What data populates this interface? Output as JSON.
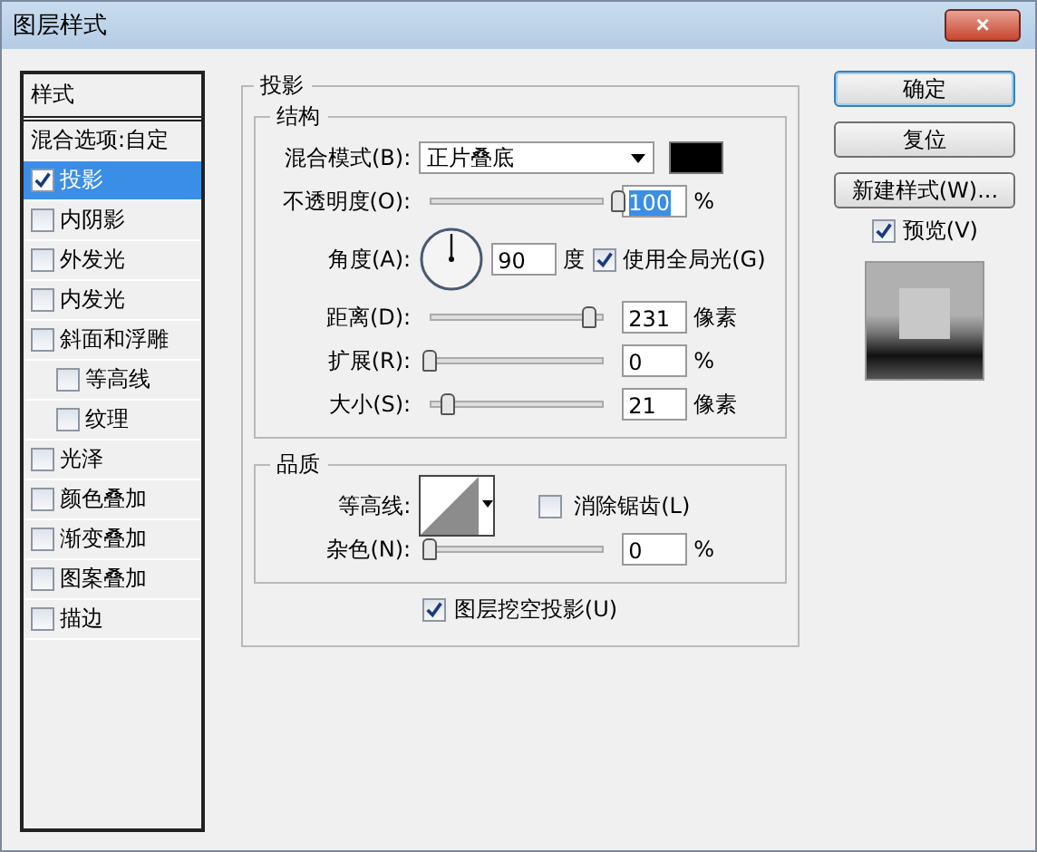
{
  "window": {
    "title": "图层样式",
    "close_button": "×"
  },
  "styles": {
    "header": "样式",
    "items": [
      {
        "label": "混合选项:自定",
        "kind": "plain",
        "selected": false
      },
      {
        "label": "投影",
        "kind": "check",
        "checked": true,
        "selected": true
      },
      {
        "label": "内阴影",
        "kind": "check",
        "checked": false,
        "selected": false
      },
      {
        "label": "外发光",
        "kind": "check",
        "checked": false,
        "selected": false
      },
      {
        "label": "内发光",
        "kind": "check",
        "checked": false,
        "selected": false
      },
      {
        "label": "斜面和浮雕",
        "kind": "check",
        "checked": false,
        "selected": false,
        "children": [
          {
            "label": "等高线",
            "kind": "check",
            "checked": false,
            "selected": false
          },
          {
            "label": "纹理",
            "kind": "check",
            "checked": false,
            "selected": false
          }
        ]
      },
      {
        "label": "光泽",
        "kind": "check",
        "checked": false,
        "selected": false
      },
      {
        "label": "颜色叠加",
        "kind": "check",
        "checked": false,
        "selected": false
      },
      {
        "label": "渐变叠加",
        "kind": "check",
        "checked": false,
        "selected": false
      },
      {
        "label": "图案叠加",
        "kind": "check",
        "checked": false,
        "selected": false
      },
      {
        "label": "描边",
        "kind": "check",
        "checked": false,
        "selected": false
      }
    ]
  },
  "panel": {
    "title": "投影",
    "structure": {
      "title": "结构",
      "blend_mode": {
        "label": "混合模式(B):",
        "value": "正片叠底",
        "color": "#000000"
      },
      "rows": [
        {
          "kind": "slider",
          "label": "不透明度(O):",
          "level": 1.0,
          "value": "100",
          "unit": "%",
          "highlighted": true
        },
        {
          "kind": "angle",
          "label": "角度(A):",
          "value": "90",
          "unit": "度",
          "checkbox": {
            "label": "使用全局光(G)",
            "checked": true
          }
        },
        {
          "kind": "slider",
          "label": "距离(D):",
          "level": 0.85,
          "value": "231",
          "unit": "像素",
          "highlighted": false
        },
        {
          "kind": "slider",
          "label": "扩展(R):",
          "level": 0.0,
          "value": "0",
          "unit": "%",
          "highlighted": false
        },
        {
          "kind": "slider",
          "label": "大小(S):",
          "level": 0.1,
          "value": "21",
          "unit": "像素",
          "highlighted": false
        }
      ]
    },
    "quality": {
      "title": "品质",
      "contour": {
        "label": "等高线:",
        "checkbox": {
          "label": "消除锯齿(L)",
          "checked": false
        }
      },
      "noise": {
        "label": "杂色(N):",
        "level": 0.0,
        "value": "0",
        "unit": "%"
      }
    },
    "knockout": {
      "label": "图层挖空投影(U)",
      "checked": true
    }
  },
  "buttons": [
    {
      "label": "确定",
      "default": true
    },
    {
      "label": "复位",
      "default": false
    },
    {
      "label": "新建样式(W)...",
      "default": false
    }
  ],
  "preview": {
    "label": "预览(V)",
    "checked": true
  }
}
